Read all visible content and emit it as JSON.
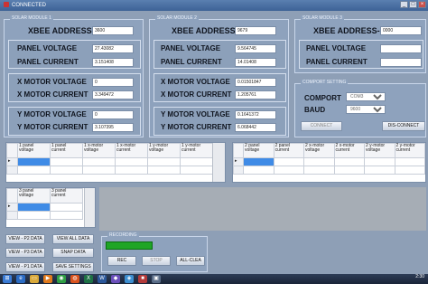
{
  "window": {
    "title": "CONNECTED"
  },
  "modules": [
    {
      "title": "SOLAR MODULE 1",
      "xbee_label": "XBEE ADDRESS-",
      "xbee_value": "3600",
      "panel_voltage_label": "PANEL VOLTAGE",
      "panel_voltage": "27.43082",
      "panel_current_label": "PANEL CURRENT",
      "panel_current": "3.151408",
      "x_voltage_label": "X MOTOR VOLTAGE",
      "x_voltage": "0",
      "x_current_label": "X MOTOR CURRENT",
      "x_current": "3.349472",
      "y_voltage_label": "Y MOTOR VOLTAGE",
      "y_voltage": "0",
      "y_current_label": "Y MOTOR CURRENT",
      "y_current": "3.107395"
    },
    {
      "title": "SOLAR MODULE 2",
      "xbee_label": "XBEE ADDRESS-",
      "xbee_value": "9679",
      "panel_voltage_label": "PANEL VOLTAGE",
      "panel_voltage": "9.564745",
      "panel_current_label": "PANEL CURRENT",
      "panel_current": "14.01408",
      "x_voltage_label": "X MOTOR VOLTAGE",
      "x_voltage": "0.01501847",
      "x_current_label": "X MOTOR CURRENT",
      "x_current": "1.205761",
      "y_voltage_label": "Y MOTOR VOLTAGE",
      "y_voltage": "0.1641372",
      "y_current_label": "Y MOTOR CURRENT",
      "y_current": "6.068442"
    },
    {
      "title": "SOLAR MODULE 3",
      "xbee_label": "XBEE ADDRESS-",
      "xbee_value": "0000",
      "panel_voltage_label": "PANEL VOLTAGE",
      "panel_voltage": "",
      "panel_current_label": "PANEL CURRENT",
      "panel_current": ""
    }
  ],
  "comport": {
    "title": "COMPORT SETTING",
    "comport_label": "COMPORT",
    "comport_value": "COM3",
    "baud_label": "BAUD",
    "baud_value": "9600",
    "connect": "CONNECT",
    "disconnect": "DIS-CONNECT"
  },
  "grid1": {
    "headers": [
      "1 panel voltage",
      "1 panel current",
      "1 x-motor voltage",
      "1 x-motor current",
      "1 y-motor voltage",
      "1 y-motor current"
    ]
  },
  "grid2": {
    "headers": [
      "2 panel voltage",
      "2 panel current",
      "2 x-motor voltage",
      "2 x-motor current",
      "2 y-motor voltage",
      "2 y-motor current"
    ]
  },
  "grid3": {
    "headers": [
      "3 panel voltage",
      "3 panel current"
    ]
  },
  "buttons": {
    "view_p2": "VIEW - P2 DATA",
    "view_all": "VIEW ALL DATA",
    "view_p3": "VIEW - P3 DATA",
    "snap": "SNAP DATA",
    "view_p1": "VIEW - P1 DATA",
    "save": "SAVE SETTINGS"
  },
  "recording": {
    "title": "RECORDING",
    "rec": "REC",
    "stop": "STOP",
    "clear": "ALL-CLEA",
    "progress": 1.0
  },
  "taskbar": {
    "time": "2:30"
  },
  "colors": {
    "progress": "#1fa526",
    "selected_cell": "#3f8be6"
  }
}
